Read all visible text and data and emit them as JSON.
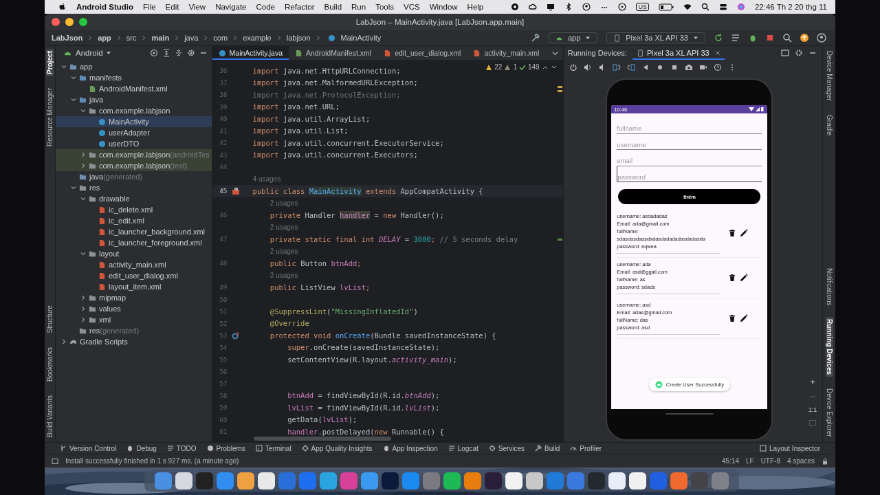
{
  "menu_bar": {
    "app_name": "Android Studio",
    "menus": [
      "File",
      "Edit",
      "View",
      "Navigate",
      "Code",
      "Refactor",
      "Build",
      "Run",
      "Tools",
      "VCS",
      "Window",
      "Help"
    ],
    "input_source": "US",
    "clock": "22:46 Th 2 20 thg 11"
  },
  "window": {
    "title": "LabJson – MainActivity.java [LabJson.app.main]"
  },
  "breadcrumbs": [
    "LabJson",
    "app",
    "src",
    "main",
    "java",
    "com",
    "example",
    "labjson",
    "MainActivity"
  ],
  "run_config": "app",
  "device_selector": "Pixel 3a XL API 33",
  "left_stripe": [
    {
      "label": "Project",
      "selected": true
    },
    {
      "label": "Resource Manager",
      "selected": false
    },
    {
      "label": "Structure",
      "selected": false
    },
    {
      "label": "Bookmarks",
      "selected": false
    },
    {
      "label": "Build Variants",
      "selected": false
    }
  ],
  "project": {
    "view": "Android",
    "tree": [
      {
        "label": "app",
        "kind": "module",
        "expanded": true,
        "selected": false,
        "children": [
          {
            "label": "manifests",
            "kind": "folder",
            "expanded": true,
            "selected": false,
            "children": [
              {
                "label": "AndroidManifest.xml",
                "kind": "manifest",
                "selected": false
              }
            ]
          },
          {
            "label": "java",
            "kind": "folder",
            "expanded": true,
            "selected": false,
            "children": [
              {
                "label": "com.example.labjson",
                "kind": "package",
                "expanded": true,
                "selected": false,
                "children": [
                  {
                    "label": "MainActivity",
                    "kind": "class",
                    "selected": true
                  },
                  {
                    "label": "userAdapter",
                    "kind": "class",
                    "selected": false
                  },
                  {
                    "label": "userDTO",
                    "kind": "class",
                    "selected": false
                  }
                ]
              },
              {
                "label": "com.example.labjson",
                "note": "(androidTes",
                "kind": "package",
                "expanded": false,
                "selected": false,
                "tinted": true
              },
              {
                "label": "com.example.labjson",
                "note": "(test)",
                "kind": "package",
                "expanded": false,
                "selected": false,
                "tinted": true
              }
            ]
          },
          {
            "label": "java",
            "note": "(generated)",
            "kind": "generated",
            "selected": false
          },
          {
            "label": "res",
            "kind": "res",
            "expanded": true,
            "selected": false,
            "children": [
              {
                "label": "drawable",
                "kind": "package",
                "expanded": true,
                "selected": false,
                "children": [
                  {
                    "label": "ic_delete.xml",
                    "kind": "xml",
                    "selected": false
                  },
                  {
                    "label": "ic_edit.xml",
                    "kind": "xml",
                    "selected": false
                  },
                  {
                    "label": "ic_launcher_background.xml",
                    "kind": "xml",
                    "selected": false
                  },
                  {
                    "label": "ic_launcher_foreground.xml",
                    "kind": "xml",
                    "selected": false
                  }
                ]
              },
              {
                "label": "layout",
                "kind": "package",
                "expanded": true,
                "selected": false,
                "children": [
                  {
                    "label": "activity_main.xml",
                    "kind": "xml",
                    "selected": false
                  },
                  {
                    "label": "edit_user_dialog.xml",
                    "kind": "xml",
                    "selected": false
                  },
                  {
                    "label": "layout_item.xml",
                    "kind": "xml",
                    "selected": false
                  }
                ]
              },
              {
                "label": "mipmap",
                "kind": "package",
                "expanded": false,
                "selected": false
              },
              {
                "label": "values",
                "kind": "package",
                "expanded": false,
                "selected": false
              },
              {
                "label": "xml",
                "kind": "package",
                "expanded": false,
                "selected": false
              }
            ]
          },
          {
            "label": "res",
            "note": "(generated)",
            "kind": "res",
            "selected": false
          }
        ]
      },
      {
        "label": "Gradle Scripts",
        "kind": "gradle",
        "expanded": false,
        "selected": false
      }
    ]
  },
  "editor_tabs": [
    {
      "label": "MainActivity.java",
      "kind": "class",
      "selected": true
    },
    {
      "label": "AndroidManifest.xml",
      "kind": "manifest",
      "selected": false
    },
    {
      "label": "edit_user_dialog.xml",
      "kind": "xml",
      "selected": false
    },
    {
      "label": "activity_main.xml",
      "kind": "xml",
      "selected": false
    }
  ],
  "inspections": {
    "warnings": "22",
    "weak_warnings": "1",
    "ok": "149"
  },
  "code": [
    {
      "kind": "line",
      "number": "36",
      "segments": [
        {
          "text": "import",
          "kind": "kw"
        },
        {
          "text": " java.net.HttpURLConnection;",
          "kind": "plain"
        }
      ]
    },
    {
      "kind": "line",
      "number": "37",
      "segments": [
        {
          "text": "import",
          "kind": "kw"
        },
        {
          "text": " java.net.MalformedURLException;",
          "kind": "plain"
        }
      ]
    },
    {
      "kind": "line",
      "number": "38",
      "segments": [
        {
          "text": "import java.net.ProtocolException;",
          "kind": "unused"
        }
      ]
    },
    {
      "kind": "line",
      "number": "39",
      "segments": [
        {
          "text": "import",
          "kind": "kw"
        },
        {
          "text": " java.net.URL;",
          "kind": "plain"
        }
      ]
    },
    {
      "kind": "line",
      "number": "40",
      "segments": [
        {
          "text": "import",
          "kind": "kw"
        },
        {
          "text": " java.util.ArrayList;",
          "kind": "plain"
        }
      ]
    },
    {
      "kind": "line",
      "number": "41",
      "segments": [
        {
          "text": "import",
          "kind": "kw"
        },
        {
          "text": " java.util.List;",
          "kind": "plain"
        }
      ]
    },
    {
      "kind": "line",
      "number": "42",
      "segments": [
        {
          "text": "import",
          "kind": "kw"
        },
        {
          "text": " java.util.concurrent.ExecutorService;",
          "kind": "plain"
        }
      ]
    },
    {
      "kind": "line",
      "number": "43",
      "segments": [
        {
          "text": "import",
          "kind": "kw"
        },
        {
          "text": " java.util.concurrent.Executors;",
          "kind": "plain"
        }
      ]
    },
    {
      "kind": "line",
      "number": "44"
    },
    {
      "kind": "hint",
      "text": "4 usages"
    },
    {
      "kind": "class_line",
      "number": "45",
      "current": true,
      "segments": [
        {
          "text": "public class ",
          "kind": "kw"
        },
        {
          "text": "MainActivity",
          "kind": "decl"
        },
        {
          "text": " extends ",
          "kind": "kw"
        },
        {
          "text": "AppCompatActivity {",
          "kind": "plain"
        }
      ]
    },
    {
      "kind": "hint",
      "text": "2 usages"
    },
    {
      "kind": "line",
      "number": "46",
      "segments": [
        {
          "text": "    private ",
          "kind": "kw"
        },
        {
          "text": "Handler ",
          "kind": "plain"
        },
        {
          "text": "handler",
          "kind": "match"
        },
        {
          "text": " = ",
          "kind": "plain"
        },
        {
          "text": "new ",
          "kind": "kw"
        },
        {
          "text": "Handler();",
          "kind": "plain"
        }
      ]
    },
    {
      "kind": "hint",
      "text": "2 usages"
    },
    {
      "kind": "line",
      "number": "47",
      "segments": [
        {
          "text": "    private static final int ",
          "kind": "kw"
        },
        {
          "text": "DELAY",
          "kind": "const"
        },
        {
          "text": " = ",
          "kind": "plain"
        },
        {
          "text": "3000",
          "kind": "num"
        },
        {
          "text": "; ",
          "kind": "kw"
        },
        {
          "text": "// 5 seconds delay",
          "kind": "comment"
        }
      ]
    },
    {
      "kind": "hint",
      "text": "2 usages"
    },
    {
      "kind": "line",
      "number": "48",
      "segments": [
        {
          "text": "    public ",
          "kind": "kw"
        },
        {
          "text": "Button ",
          "kind": "plain"
        },
        {
          "text": "btnAdd",
          "kind": "field"
        },
        {
          "text": ";",
          "kind": "kw"
        }
      ]
    },
    {
      "kind": "hint",
      "text": "3 usages"
    },
    {
      "kind": "line",
      "number": "49",
      "segments": [
        {
          "text": "    public ",
          "kind": "kw"
        },
        {
          "text": "ListView ",
          "kind": "plain"
        },
        {
          "text": "lvList",
          "kind": "field"
        },
        {
          "text": ";",
          "kind": "kw"
        }
      ]
    },
    {
      "kind": "line",
      "number": "50"
    },
    {
      "kind": "line",
      "number": "51",
      "segments": [
        {
          "text": "    @SuppressLint",
          "kind": "annot"
        },
        {
          "text": "(",
          "kind": "plain"
        },
        {
          "text": "\"MissingInflatedId\"",
          "kind": "str"
        },
        {
          "text": ")",
          "kind": "plain"
        }
      ]
    },
    {
      "kind": "line",
      "number": "52",
      "segments": [
        {
          "text": "    @Override",
          "kind": "annot"
        }
      ]
    },
    {
      "kind": "override_line",
      "number": "53",
      "segments": [
        {
          "text": "    protected void ",
          "kind": "kw"
        },
        {
          "text": "onCreate",
          "kind": "fn"
        },
        {
          "text": "(Bundle savedInstanceState) {",
          "kind": "plain"
        }
      ]
    },
    {
      "kind": "line",
      "number": "54",
      "segments": [
        {
          "text": "        super",
          "kind": "kw"
        },
        {
          "text": ".onCreate(savedInstanceState);",
          "kind": "plain"
        }
      ]
    },
    {
      "kind": "line",
      "number": "55",
      "segments": [
        {
          "text": "        setContentView(R.layout.",
          "kind": "plain"
        },
        {
          "text": "activity_main",
          "kind": "const"
        },
        {
          "text": ");",
          "kind": "plain"
        }
      ]
    },
    {
      "kind": "line",
      "number": "56"
    },
    {
      "kind": "line",
      "number": "57"
    },
    {
      "kind": "line",
      "number": "58",
      "segments": [
        {
          "text": "        btnAdd",
          "kind": "field"
        },
        {
          "text": " = findViewById(R.id.",
          "kind": "plain"
        },
        {
          "text": "btnAdd",
          "kind": "const"
        },
        {
          "text": ");",
          "kind": "plain"
        }
      ]
    },
    {
      "kind": "line",
      "number": "59",
      "segments": [
        {
          "text": "        lvList",
          "kind": "field"
        },
        {
          "text": " = findViewById(R.id.",
          "kind": "plain"
        },
        {
          "text": "lvList",
          "kind": "const"
        },
        {
          "text": ");",
          "kind": "plain"
        }
      ]
    },
    {
      "kind": "line",
      "number": "60",
      "segments": [
        {
          "text": "        getData(",
          "kind": "plain"
        },
        {
          "text": "lvList",
          "kind": "field"
        },
        {
          "text": ");",
          "kind": "plain"
        }
      ]
    },
    {
      "kind": "line",
      "number": "61",
      "segments": [
        {
          "text": "        handler",
          "kind": "field"
        },
        {
          "text": ".postDelayed(",
          "kind": "plain"
        },
        {
          "text": "new ",
          "kind": "kw"
        },
        {
          "text": "Runnable() {",
          "kind": "plain"
        }
      ]
    }
  ],
  "running_devices": {
    "label": "Running Devices:",
    "tabs": [
      {
        "label": "Pixel 3a XL API 33",
        "selected": true
      }
    ]
  },
  "phone": {
    "time": "10:46",
    "fields": [
      {
        "placeholder": "fullname",
        "focused": false
      },
      {
        "placeholder": "username",
        "focused": false
      },
      {
        "placeholder": "email",
        "focused": false
      },
      {
        "placeholder": "password",
        "focused": true
      }
    ],
    "button": "thêm",
    "users": [
      {
        "lines": [
          "username: asdadadas",
          "Email: ada@gmail.com",
          "fullName: sdasdasdaasdadasdadadadasdadasda",
          "password: eqwea"
        ]
      },
      {
        "lines": [
          "username: ada",
          "Email: asd@ggail.com",
          "fullName: as",
          "password: sdads"
        ]
      },
      {
        "lines": [
          "username: asd",
          "Email: adas@gmail.com",
          "fullName: das",
          "password: asd"
        ]
      }
    ],
    "toast": "Create User Successfully"
  },
  "zoom_controls": {
    "plus": "+",
    "actual_size": "1:1"
  },
  "right_stripe": [
    {
      "label": "Device Manager",
      "selected": false
    },
    {
      "label": "Gradle",
      "selected": false
    },
    {
      "label": "Notifications",
      "selected": false
    },
    {
      "label": "Running Devices",
      "selected": true
    },
    {
      "label": "Device Explorer",
      "selected": false
    }
  ],
  "bottom_tools": [
    {
      "label": "Version Control",
      "kind": "branch"
    },
    {
      "label": "Debug",
      "kind": "bug"
    },
    {
      "label": "TODO",
      "kind": "list"
    },
    {
      "label": "Problems",
      "kind": "info"
    },
    {
      "label": "Terminal",
      "kind": "terminal"
    },
    {
      "label": "App Quality Insights",
      "kind": "diamond"
    },
    {
      "label": "App Inspection",
      "kind": "bug"
    },
    {
      "label": "Logcat",
      "kind": "list"
    },
    {
      "label": "Services",
      "kind": "gear"
    },
    {
      "label": "Build",
      "kind": "hammer"
    },
    {
      "label": "Profiler",
      "kind": "gauge"
    }
  ],
  "layout_inspector": "Layout Inspector",
  "status_bar": {
    "message": "Install successfully finished in 1 s 927 ms. (a minute ago)",
    "items": [
      "45:14",
      "LF",
      "UTF-8",
      "4 spaces"
    ]
  },
  "dock": [
    {
      "color": "#4a90e2"
    },
    {
      "color": "#d8d8e0"
    },
    {
      "color": "#222222"
    },
    {
      "color": "#2f8ef0"
    },
    {
      "color": "#f0a040"
    },
    {
      "color": "#e8e8e8"
    },
    {
      "color": "#2a6fd8"
    },
    {
      "color": "#1e6ff0"
    },
    {
      "color": "#2aa4e0"
    },
    {
      "color": "#d8409a"
    },
    {
      "color": "#3a9af0"
    },
    {
      "color": "#0a1a3a"
    },
    {
      "color": "#1a8af0"
    },
    {
      "color": "#7a7a80"
    },
    {
      "color": "#1db954"
    },
    {
      "color": "#e87d0d"
    },
    {
      "color": "#2a1f3a"
    },
    {
      "color": "#f2f2f2"
    },
    {
      "color": "#c8c8c8"
    },
    {
      "color": "#1f7ad8"
    },
    {
      "color": "#3a7ae0"
    },
    {
      "color": "#24292e"
    },
    {
      "color": "#e8eef8"
    },
    {
      "color": "#f0f0f0"
    },
    {
      "color": "#2060e0"
    },
    {
      "color": "#f06a30"
    },
    {
      "color": "#444448"
    },
    {
      "color": "#808088"
    }
  ]
}
